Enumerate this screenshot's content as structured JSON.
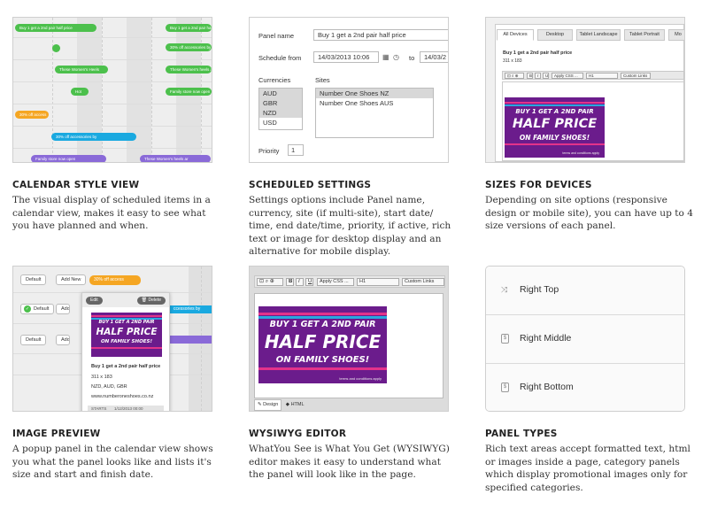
{
  "cards": [
    {
      "title": "CALENDAR STYLE VIEW",
      "desc": "The visual display of scheduled items in a calendar view, makes it easy to see what you have planned and when.",
      "bars": [
        {
          "label": "Buy 1 get a 2nd pair half price"
        },
        {
          "label": "Buy 1 get a 2nd pair half price"
        },
        {
          "label": "30% off accessories by"
        },
        {
          "label": "These Women's Heels"
        },
        {
          "label": "These Women's heels ar"
        },
        {
          "label": "Hot"
        },
        {
          "label": "Family store now open"
        },
        {
          "label": "30% off access"
        },
        {
          "label": "30% off accessories by"
        },
        {
          "label": "Family store now open"
        },
        {
          "label": "These Women's heels ar"
        }
      ]
    },
    {
      "title": "SCHEDULED SETTINGS",
      "desc": "Settings options include Panel name, currency, site (if multi-site), start date/ time, end date/time, priority, if active, rich text or image for desktop display and an alternative for mobile display.",
      "panel_name_label": "Panel name",
      "panel_name_value": "Buy 1 get a 2nd pair half price",
      "schedule_label": "Schedule from",
      "schedule_from": "14/03/2013 10:06",
      "schedule_to_label": "to",
      "schedule_to": "14/03/2",
      "currencies_label": "Currencies",
      "currencies": [
        "AUD",
        "GBR",
        "NZD",
        "USD"
      ],
      "sites_label": "Sites",
      "sites": [
        "Number One Shoes NZ",
        "Number One Shoes AUS"
      ],
      "priority_label": "Priority",
      "priority_value": "1"
    },
    {
      "title": "SIZES FOR DEVICES",
      "desc": "Depending on site options (responsive design or mobile site), you can have up to 4 size versions of each panel.",
      "tabs": [
        "All Devices",
        "Desktop",
        "Tablet Landscape",
        "Tablet Portrait",
        "Mo"
      ],
      "panel_title": "Buy 1 get a 2nd pair half price",
      "panel_size": "311 x 183",
      "toolbar_style": "Apply CSS ...",
      "toolbar_format": "H1",
      "toolbar_links": "Custom Links"
    },
    {
      "title": "IMAGE PREVIEW",
      "desc": "A popup panel in the calendar view shows you what the panel looks like and lists it's size and start and finish date.",
      "btn_default": "Default",
      "btn_add_new": "Add New",
      "btn_add": "Add",
      "offer_label": "30% off access",
      "edit_label": "Edit",
      "delete_label": "Delete",
      "side_bar_blue": "ccessories by",
      "popup_title": "Buy 1 get a 2nd pair half price",
      "popup_size": "311 x 183",
      "popup_currencies": "NZD, AUD, GBR",
      "popup_url": "www.numberoneshoes.co.nz",
      "popup_starts_label": "STARTS",
      "popup_starts": "1/12/2013 00:00"
    },
    {
      "title": "WYSIWYG EDITOR",
      "desc": "WhatYou See is What You Get (WYSIWYG) editor makes it easy to understand what the panel will look like in the page.",
      "toolbar_style": "Apply CSS ...",
      "toolbar_format": "H1",
      "toolbar_links": "Custom Links",
      "design_tab": "Design",
      "html_tab": "HTML"
    },
    {
      "title": "PANEL TYPES",
      "desc": "Rich text areas accept formatted text, html or images inside a page, category panels which display promotional images only for specified categories.",
      "panels": [
        "Right Top",
        "Right Middle",
        "Right Bottom"
      ]
    }
  ],
  "banner": {
    "line1": "BUY 1 GET A 2ND PAIR",
    "line2": "HALF PRICE",
    "line3": "ON FAMILY SHOES!",
    "terms": "terms and conditions apply"
  },
  "colors": {
    "green": "#4cc04c",
    "orange": "#f5a623",
    "blue": "#1aa9e0",
    "purple": "#8a6ad8",
    "banner": "#6b1c8c"
  }
}
